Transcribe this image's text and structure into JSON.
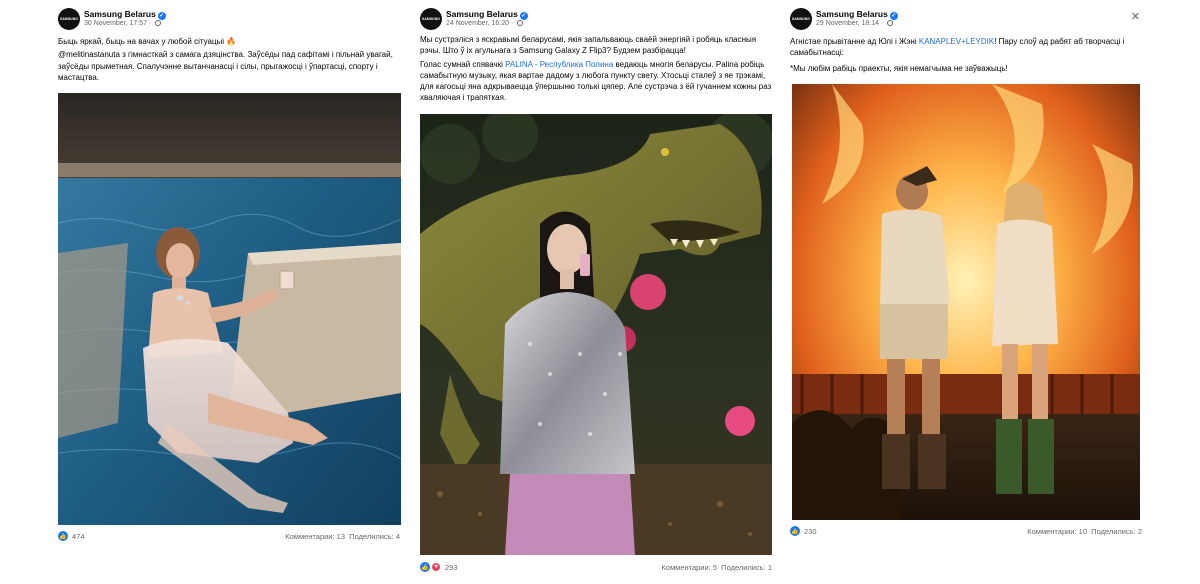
{
  "posts": [
    {
      "author": "Samsung Belarus",
      "avatar_text": "SAMSUNG",
      "date": "30 November, 17:57",
      "paragraphs": [
        "Быць яркай, быць на вачах у любой сітуацыі 🔥",
        "@melitinastanuta з гімнасткай з самага дзяцінства. Заўсёды пад сафітамі і пільнай увагай, заўсёды прыметная. Спалучэнне вытанчанасці і сілы, прыгажосці і ўпартасці, спорту і мастацтва."
      ],
      "likes": "474",
      "comments": "Комментарии: 13",
      "shares": "Поделились: 4",
      "image_desc": "pool-photo"
    },
    {
      "author": "Samsung Belarus",
      "avatar_text": "SAMSUNG",
      "date": "24 November, 16:20",
      "p1": "Мы сустрэліся з яскравымі беларусамі, якія запальваюць сваёй энергіяй і робяць класныя рэчы. Што ў іх агульнага з Samsung Galaxy Z Flip3? Будзем разбірацца!",
      "p2_before": "Голас сумнай спявачкі ",
      "p2_link": "PALINA - Республика Полина",
      "p2_after": " ведаюць многія беларусы. Palina робіць самабытную музыку, якая вартае дадому з любога пункту свету. Хтосьці сталеў з яе трэкамі, для кагосьці яна адкрываецца ўпершыню толькі цяпер. Але сустрэча з ёй гучаннем кожны раз хваляючая і трапяткая.",
      "likes": "293",
      "comments": "Комментарии: 5",
      "shares": "Поделились: 1"
    },
    {
      "author": "Samsung Belarus",
      "avatar_text": "SAMSUNG",
      "date": "29 November, 18:14",
      "p1_before": "Агністае прывітанне ад Юлі і Жэні ",
      "p1_link": "KANAPLEV+LEYDIK",
      "p1_after": "! Пару слоў ад рабят аб творчасці і самабытнасці:",
      "p2": "*Мы любім рабіць праекты, якія немагчыма не заўважыць!",
      "likes": "230",
      "comments": "Комментарии: 10",
      "shares": "Поделились: 2"
    }
  ],
  "colors": {
    "verified": "#1877f2",
    "link": "#216fdb",
    "meta": "#65676b"
  }
}
